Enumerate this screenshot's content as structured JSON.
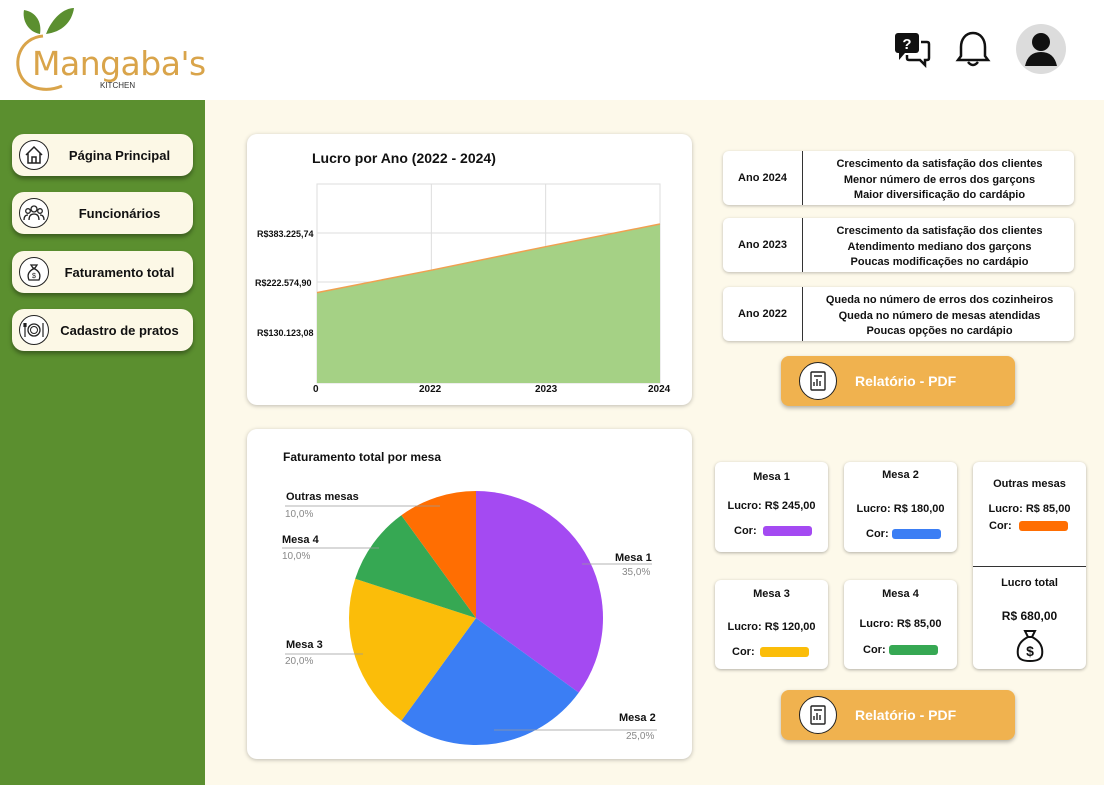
{
  "brand": {
    "name": "Mangaba's",
    "sub": "KITCHEN",
    "color": "#d9a44a"
  },
  "header": {
    "icons": [
      "help-chat-icon",
      "bell-icon",
      "user-avatar-icon"
    ]
  },
  "sidebar": {
    "color": "#5b8f2f",
    "items": [
      {
        "label": "Página Principal",
        "icon": "home-icon"
      },
      {
        "label": "Funcionários",
        "icon": "people-icon"
      },
      {
        "label": "Faturamento total",
        "icon": "money-bag-icon"
      },
      {
        "label": "Cadastro de pratos",
        "icon": "plate-icon"
      }
    ]
  },
  "profit_chart": {
    "title": "Lucro por Ano (2022 -  2024)",
    "y_ticks": [
      "R$383.225,74",
      "R$222.574,90",
      "R$130.123,08"
    ],
    "x_ticks": [
      "0",
      "2022",
      "2023",
      "2024"
    ]
  },
  "years": [
    {
      "year": "Ano 2024",
      "lines": [
        "Crescimento da satisfação dos clientes",
        "Menor número de erros dos garçons",
        "Maior diversificação do cardápio"
      ]
    },
    {
      "year": "Ano 2023",
      "lines": [
        "Crescimento da satisfação dos clientes",
        "Atendimento mediano dos garçons",
        "Poucas modificações no cardápio"
      ]
    },
    {
      "year": "Ano 2022",
      "lines": [
        "Queda no número de erros dos cozinheiros",
        "Queda no número de mesas atendidas",
        "Poucas opções no cardápio"
      ]
    }
  ],
  "pdf_button": {
    "label": "Relatório -  PDF"
  },
  "chart_data": [
    {
      "type": "area",
      "title": "Lucro por Ano (2022 -  2024)",
      "x": [
        "0",
        "2022",
        "2023",
        "2024"
      ],
      "series": [
        {
          "values": [
            222574.9,
            275000,
            330000,
            383225.74
          ]
        }
      ],
      "color": "#a5d185",
      "line_color": "#f0a050"
    },
    {
      "type": "pie",
      "title": "Faturamento total por mesa",
      "slices": [
        {
          "label": "Mesa 1",
          "pct": "35,0%",
          "value": 35,
          "color": "#a44af2"
        },
        {
          "label": "Mesa 2",
          "pct": "25,0%",
          "value": 25,
          "color": "#3b7ef4"
        },
        {
          "label": "Mesa 3",
          "pct": "20,0%",
          "value": 20,
          "color": "#fbbd09"
        },
        {
          "label": "Mesa 4",
          "pct": "10,0%",
          "value": 10,
          "color": "#36a853"
        },
        {
          "label": "Outras mesas",
          "pct": "10,0%",
          "value": 10,
          "color": "#ff6e02"
        }
      ]
    }
  ],
  "mesas": [
    {
      "name": "Mesa 1",
      "lucro_label": "Lucro:",
      "lucro": "R$ 245,00",
      "cor_label": "Cor:",
      "color": "#a44af2"
    },
    {
      "name": "Mesa 2",
      "lucro_label": "Lucro:",
      "lucro": "R$ 180,00",
      "cor_label": "Cor:",
      "color": "#3b7ef4"
    },
    {
      "name": "Outras mesas",
      "lucro_label": "Lucro:",
      "lucro": "R$ 85,00",
      "cor_label": "Cor:",
      "color": "#ff6e02"
    },
    {
      "name": "Mesa 3",
      "lucro_label": "Lucro:",
      "lucro": "R$ 120,00",
      "cor_label": "Cor:",
      "color": "#fbbd09"
    },
    {
      "name": "Mesa 4",
      "lucro_label": "Lucro:",
      "lucro": "R$ 85,00",
      "cor_label": "Cor:",
      "color": "#36a853"
    }
  ],
  "total": {
    "label": "Lucro total",
    "value": "R$ 680,00"
  }
}
